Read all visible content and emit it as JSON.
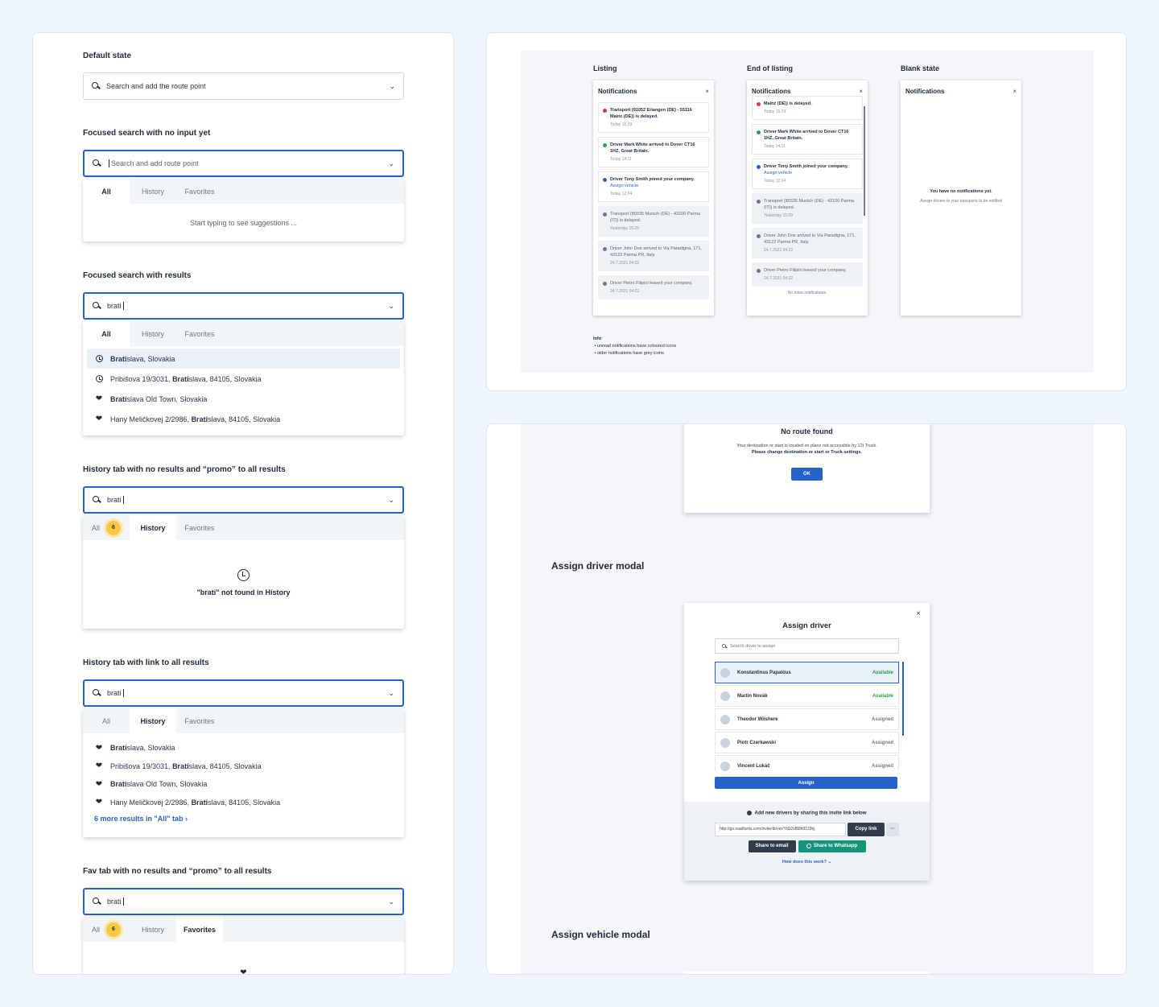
{
  "search": {
    "default_label": "Default state",
    "default_placeholder": "Search and add the route point",
    "focused_label": "Focused search with no input yet",
    "focused_placeholder": "Search and add route point",
    "empty_hint": "Start typing to see suggestions ...",
    "tabs": {
      "all": "All",
      "history": "History",
      "favorites": "Favorites"
    },
    "badge_count": "6",
    "query": "brati",
    "results_label": "Focused search with results",
    "results": [
      {
        "bold": "Brati",
        "rest": "slava, Slovakia",
        "icon": "clock-icon"
      },
      {
        "pre": "Pribišova 19/3031, ",
        "bold": "Brati",
        "rest": "slava, 84105, Slovakia",
        "icon": "clock-icon"
      },
      {
        "bold": "Brati",
        "rest": "slava Old Town, Slovakia",
        "icon": "heart-icon"
      },
      {
        "pre": "Hany Meličkovej 2/2986, ",
        "bold": "Brati",
        "rest": "slava, 84105, Slovakia",
        "icon": "heart-icon"
      }
    ],
    "history_promo_label": "History tab with no results and “promo” to all results",
    "history_not_found": "\"brati\" not found in History",
    "history_link_label": "History tab with link to all results",
    "more_results": "6 more results in \"All\" tab",
    "fav_promo_label": "Fav tab with no results and “promo” to all results"
  },
  "notifications": {
    "listing_label": "Listing",
    "end_label": "End of listing",
    "blank_label": "Blank state",
    "title": "Notifications",
    "close": "×",
    "listing": [
      {
        "text": "Transport (91052 Erlangen (DE) - 55116 Mainz (DE)) is delayed.",
        "time": "Today 15:29",
        "color": "#e0323a",
        "old": false
      },
      {
        "text": "Driver Mark White arrived to Dover CT16 1HZ, Great Britain.",
        "time": "Today 14:11",
        "color": "#21a34a",
        "old": false
      },
      {
        "text": "Driver Tony Smith joined your company.",
        "link": "Assign vehicle",
        "time": "Today 12:24",
        "color": "#2463c9",
        "old": false
      },
      {
        "text": "Transport (80335 Munich (DE) - 43100 Parma (IT)) is delayed.",
        "time": "Yesterday 15:29",
        "color": "#6d7887",
        "old": true
      },
      {
        "text": "Driver John Doe arrived to Via Paradigna, 171, 43122 Parma PR, Italy.",
        "time": "24.7.2021 04:22",
        "color": "#6d7887",
        "old": true
      },
      {
        "text": "Driver Pietro Filipini leaved your company.",
        "time": "24.7.2021 04:22",
        "color": "#6d7887",
        "old": true
      }
    ],
    "end": [
      {
        "text": "Mainz (DE)) is delayed.",
        "time": "Today 15:29",
        "color": "#e0323a",
        "old": false
      },
      {
        "text": "Driver Mark White arrived to Dover CT16 1HZ, Great Britain.",
        "time": "Today 14:11",
        "color": "#21a34a",
        "old": false
      },
      {
        "text": "Driver Tony Smith joined your company.",
        "link": "Assign vehicle",
        "time": "Today 12:24",
        "color": "#2463c9",
        "old": false
      },
      {
        "text": "Transport (80335 Munich (DE) - 43100 Parma (IT)) is delayed.",
        "time": "Yesterday 15:29",
        "color": "#6d7887",
        "old": true
      },
      {
        "text": "Driver John Doe arrived to Via Paradigna, 171, 43122 Parma PR, Italy.",
        "time": "24.7.2021 04:22",
        "color": "#6d7887",
        "old": true
      },
      {
        "text": "Driver Pietro Filipini leaved your company.",
        "time": "24.7.2021 04:22",
        "color": "#6d7887",
        "old": true
      }
    ],
    "no_more": "No more notifications.",
    "blank_title": "You have no notifications yet.",
    "blank_sub": "Assign drivers to your transports to be notified",
    "info_title": "Info",
    "info_items": [
      "unread notifications have coloured icons",
      "older notifications have grey icons"
    ]
  },
  "modals": {
    "no_route_title": "No route found",
    "no_route_text1": "Your destination or start is located on place not accessible by 12t Truck.",
    "no_route_text2": "Please change destination or start or Truck settings.",
    "ok": "OK",
    "assign_driver_section": "Assign driver modal",
    "assign_driver_title": "Assign driver",
    "driver_search_placeholder": "Search driver to assign",
    "drivers": [
      {
        "name": "Konstantinus Papalous",
        "status": "Available",
        "selected": true
      },
      {
        "name": "Martin Novák",
        "status": "Available",
        "selected": false
      },
      {
        "name": "Theodor Wilshere",
        "status": "Assigned",
        "selected": false
      },
      {
        "name": "Piotr Czerkawski",
        "status": "Assigned",
        "selected": false
      },
      {
        "name": "Vincent Lukáč",
        "status": "Assigned",
        "selected": false
      }
    ],
    "assign_button": "Assign",
    "invite_text": "Add new drivers by sharing this invite link below",
    "invite_link": "http://go.roadlords.com/invite/driver/Yd32sf88h8129kj",
    "copy_link": "Copy link",
    "more": "···",
    "share_email": "Share to email",
    "share_whatsapp": "Share to Whatsapp",
    "how": "How does this work?",
    "assign_vehicle_section": "Assign vehicle modal"
  },
  "colors": {
    "accent": "#2463c9",
    "available": "#21a34a",
    "badge": "#f7c844",
    "whatsapp": "#13957a",
    "dark_button": "#323c4a"
  }
}
